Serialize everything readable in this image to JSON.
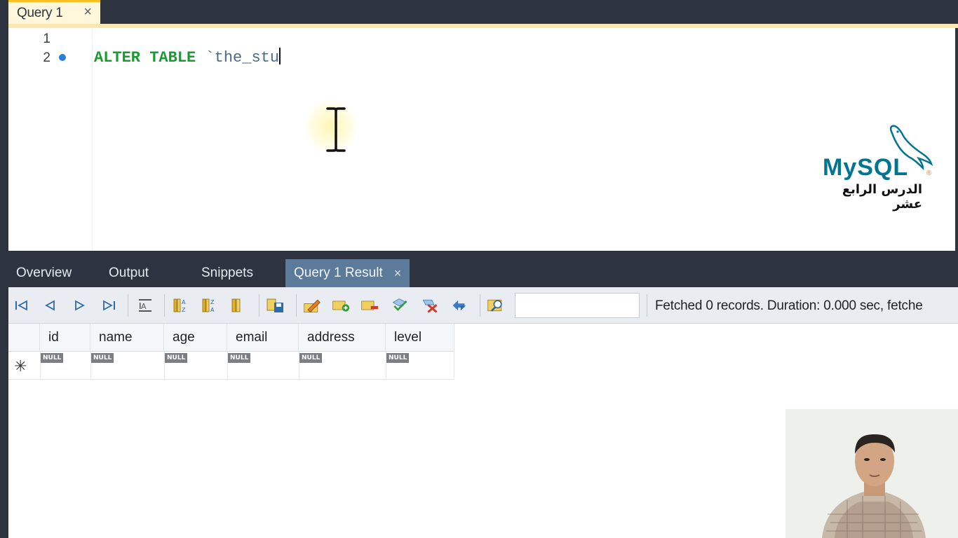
{
  "editor_tab": {
    "label": "Query 1",
    "close_glyph": "×"
  },
  "editor": {
    "line_numbers": [
      "1",
      "2"
    ],
    "code": {
      "keyword1": "ALTER",
      "keyword2": "TABLE",
      "identifier": "`the_stu"
    }
  },
  "branding": {
    "logo_text_my": "My",
    "logo_text_sql": "SQL",
    "logo_reg": "®",
    "caption": "الدرس الرابع عشر"
  },
  "result_tabs": [
    {
      "label": "Overview"
    },
    {
      "label": "Output"
    },
    {
      "label": "Snippets"
    },
    {
      "label": "Query 1 Result",
      "close_glyph": "×",
      "active": true
    }
  ],
  "toolbar": {
    "icons": [
      "first-record-icon",
      "previous-record-icon",
      "next-record-icon",
      "last-record-icon",
      "text-view-icon",
      "sort-ascending-icon",
      "sort-descending-icon",
      "column-icon",
      "save-export-icon",
      "edit-icon",
      "add-row-icon",
      "delete-row-icon",
      "apply-icon",
      "cancel-icon",
      "refresh-icon",
      "find-icon"
    ],
    "filter_value": "",
    "status": "Fetched 0 records. Duration: 0.000 sec, fetche"
  },
  "grid": {
    "columns": [
      "id",
      "name",
      "age",
      "email",
      "address",
      "level"
    ],
    "new_row_marker": "✳",
    "null_label": "NULL"
  },
  "colors": {
    "frame": "#2d3440",
    "active_tab": "#fff7db",
    "keyword": "#1a9a33",
    "mysql_blue": "#00758f",
    "result_tab_active": "#5c7a99"
  }
}
